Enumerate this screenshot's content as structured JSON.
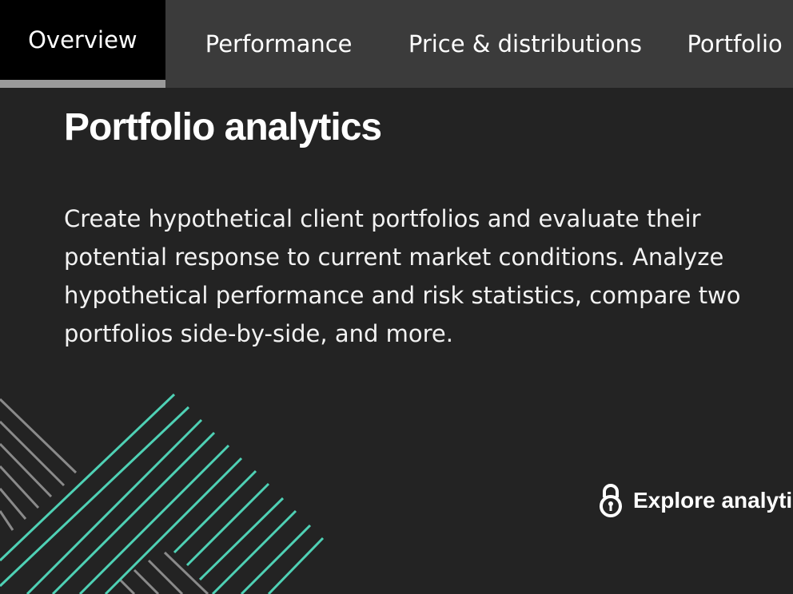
{
  "tabs": [
    {
      "label": "Overview",
      "active": true
    },
    {
      "label": "Performance",
      "active": false
    },
    {
      "label": "Price & distributions",
      "active": false
    },
    {
      "label": "Portfolio",
      "active": false
    }
  ],
  "section": {
    "title": "Portfolio analytics",
    "description": "Create hypothetical client portfolios and evaluate their potential response to current market conditions. Analyze hypothetical performance and risk statistics, compare two portfolios side-by-side, and more."
  },
  "cta": {
    "label": "Explore analytics",
    "icon": "lock-icon"
  },
  "colors": {
    "background": "#232323",
    "tabbar": "#3b3b3b",
    "active_tab": "#000000",
    "active_indicator": "#9a9a9a",
    "accent": "#4fd1b5",
    "pattern_gray": "#8a8a8a"
  }
}
